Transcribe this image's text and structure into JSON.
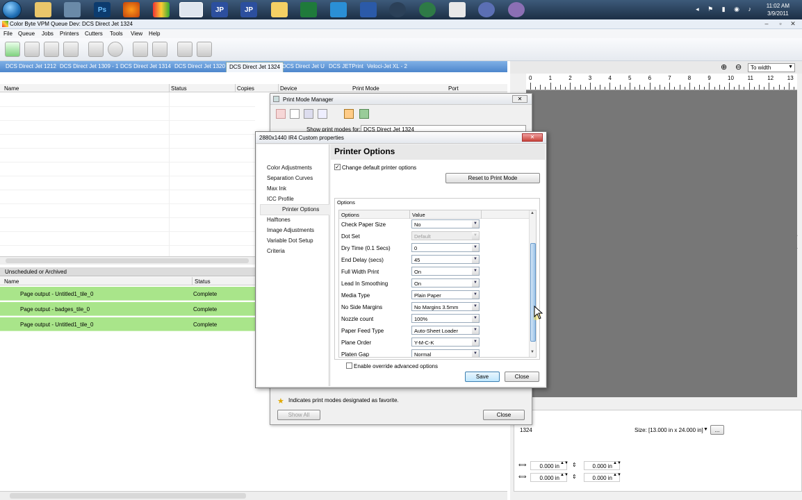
{
  "taskbar": {
    "icons": [
      "start-orb-icon",
      "explorer-icon",
      "network-icon",
      "photoshop-icon",
      "firefox-icon",
      "color-byte-icon",
      "vpm-icon",
      "jp-icon",
      "jp-icon",
      "folder-icon",
      "excel-icon",
      "ie-icon",
      "word-icon",
      "gear-icon",
      "refresh-icon",
      "tool-icon",
      "globe-icon",
      "globe-icon"
    ],
    "ps_label": "Ps",
    "jp_label_1": "JP",
    "jp_label_2": "JP",
    "clock_time": "11:02 AM",
    "clock_date": "3/9/2011"
  },
  "window": {
    "title": "Color Byte VPM Queue Dev: DCS Direct Jet 1324"
  },
  "menu": [
    "File",
    "Queue",
    "Jobs",
    "Printers",
    "Cutters",
    "Tools",
    "View",
    "Help"
  ],
  "tabs": [
    "DCS Direct Jet 1212",
    "DCS Direct Jet 1309 - 1",
    "DCS Direct Jet 1314",
    "DCS Direct Jet 1320",
    "DCS Direct Jet 1324",
    "DCS Direct Jet U",
    "DCS JETPrint",
    "Veloci-Jet XL - 2"
  ],
  "active_tab": 4,
  "queue_columns": [
    "Name",
    "Status",
    "Copies",
    "Device",
    "Print Mode",
    "Port"
  ],
  "archive": {
    "section_title": "Unscheduled or Archived",
    "columns": [
      "Name",
      "Status"
    ],
    "rows": [
      {
        "name": "Page output - Untitled1_tile_0",
        "status": "Complete"
      },
      {
        "name": "Page output - badges_tile_0",
        "status": "Complete"
      },
      {
        "name": "Page output - Untitled1_tile_0",
        "status": "Complete"
      }
    ]
  },
  "preview": {
    "zoom": "To width",
    "ruler": [
      "0",
      "1",
      "2",
      "3",
      "4",
      "5",
      "6",
      "7",
      "8",
      "9",
      "10",
      "11",
      "12",
      "13"
    ],
    "device": "1324",
    "size_label": "Size: [13.000 in x 24.000 in]",
    "more_btn": "...",
    "offsets": [
      "0.000 in",
      "0.000 in",
      "0.000 in",
      "0.000 in"
    ]
  },
  "pmm": {
    "title": "Print Mode Manager",
    "show_label": "Show print modes for:",
    "show_value": "DCS Direct Jet 1324",
    "favorite_note": "Indicates print modes designated as favorite.",
    "show_all": "Show All",
    "close": "Close"
  },
  "cpd": {
    "title": "2880x1440 IR4 Custom properties",
    "nav": [
      "Color Adjustments",
      "Separation Curves",
      "Max Ink",
      "ICC Profile",
      "Printer Options",
      "Halftones",
      "Image Adjustments",
      "Variable Dot Setup",
      "Criteria"
    ],
    "selected_nav": 4,
    "heading": "Printer Options",
    "change_default_label": "Change default printer options",
    "change_default_checked": true,
    "reset_btn": "Reset to Print Mode",
    "options_group": "Options",
    "table_headers": [
      "Options",
      "Value"
    ],
    "options": [
      {
        "name": "Check Paper Size",
        "value": "No",
        "disabled": false
      },
      {
        "name": "Dot Set",
        "value": "Default",
        "disabled": true
      },
      {
        "name": "Dry Time (0.1 Secs)",
        "value": "0",
        "disabled": false
      },
      {
        "name": "End Delay (secs)",
        "value": "45",
        "disabled": false
      },
      {
        "name": "Full Width Print",
        "value": "On",
        "disabled": false
      },
      {
        "name": "Lead In Smoothing",
        "value": "On",
        "disabled": false
      },
      {
        "name": "Media Type",
        "value": "Plain Paper",
        "disabled": false
      },
      {
        "name": "No Side Margins",
        "value": "No Margins 3.5mm",
        "disabled": false
      },
      {
        "name": "Nozzle count",
        "value": "100%",
        "disabled": false
      },
      {
        "name": "Paper Feed Type",
        "value": "Auto-Sheet Loader",
        "disabled": false
      },
      {
        "name": "Plane Order",
        "value": "Y-M-C-K",
        "disabled": false
      },
      {
        "name": "Platen Gap",
        "value": "Normal",
        "disabled": false
      }
    ],
    "scroll_position": 0.55,
    "advanced_label": "Enable override advanced options",
    "save": "Save",
    "close": "Close"
  }
}
